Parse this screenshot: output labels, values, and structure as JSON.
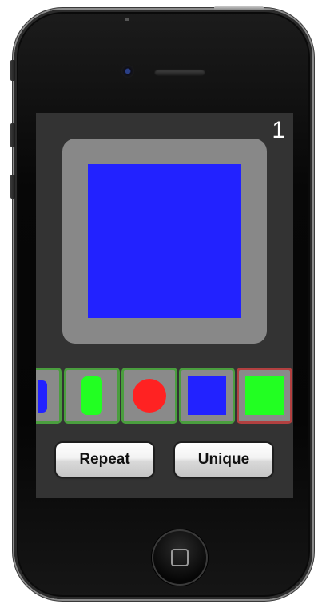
{
  "counter": "1",
  "stage": {
    "shape": "square",
    "color": "#2222ff"
  },
  "strip": {
    "tiles": [
      {
        "shape": "rounded-rect-partial",
        "color": "#2222ff",
        "selected": false
      },
      {
        "shape": "tall-rounded-rect",
        "color": "#22ff22",
        "selected": false
      },
      {
        "shape": "circle",
        "color": "#ff2222",
        "selected": false
      },
      {
        "shape": "square",
        "color": "#2222ff",
        "selected": false
      },
      {
        "shape": "square",
        "color": "#22ff22",
        "selected": true
      }
    ]
  },
  "buttons": {
    "repeat_label": "Repeat",
    "unique_label": "Unique"
  },
  "colors": {
    "screen_bg": "#333333",
    "tile_bg": "#8a8a8a",
    "tile_border": "#4a9e3e",
    "tile_selected_border": "#b24040"
  },
  "icons": {
    "home": "home-button-icon",
    "camera": "front-camera-icon",
    "speaker": "earpiece-speaker-icon"
  }
}
